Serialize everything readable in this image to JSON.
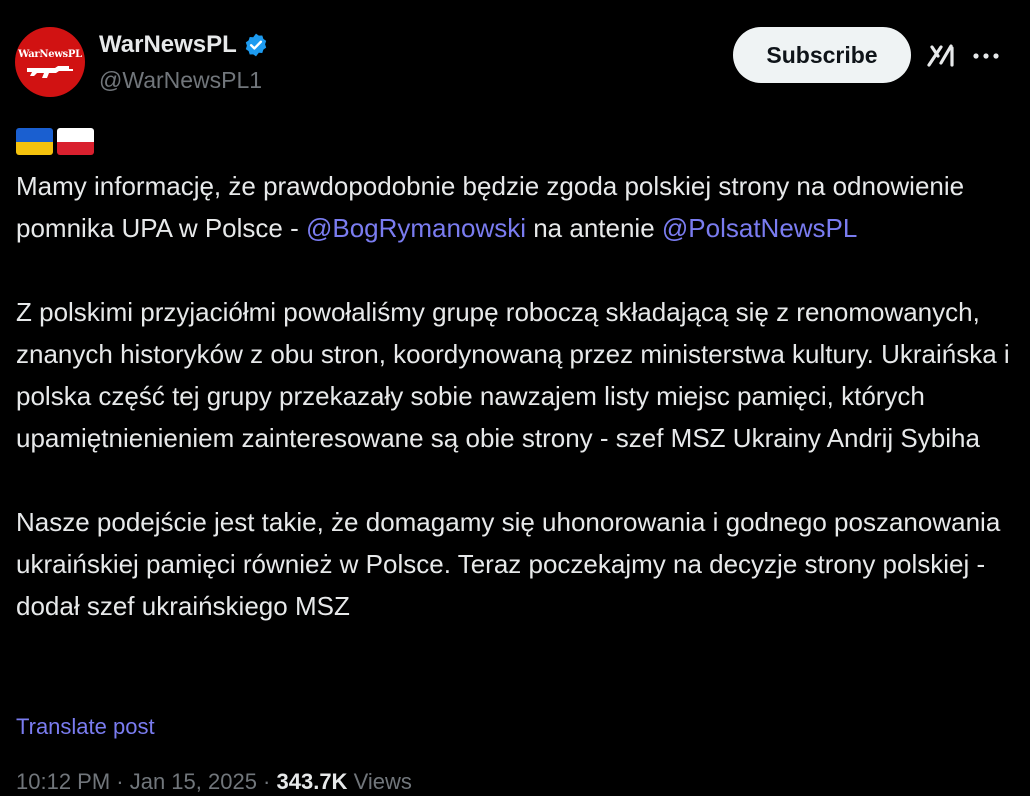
{
  "author": {
    "display_name": "WarNewsPL",
    "handle": "@WarNewsPL1",
    "avatar_text": "WarNewsPL"
  },
  "actions": {
    "subscribe_label": "Subscribe",
    "grok_icon": "grok-icon",
    "more_icon": "more-options-icon"
  },
  "flags": [
    "ukraine-flag",
    "poland-flag"
  ],
  "post": {
    "p1": {
      "text_a": "Mamy informację, że prawdopodobnie będzie zgoda polskiej strony na odnowienie pomnika UPA w Polsce - ",
      "mention_1": "@BogRymanowski",
      "text_b": " na antenie ",
      "mention_2": "@PolsatNewsPL"
    },
    "p2": "Z polskimi przyjaciółmi powołaliśmy grupę roboczą składającą się z renomowanych, znanych historyków z obu stron, koordynowaną przez ministerstwa kultury. Ukraińska i polska część tej grupy przekazały sobie nawzajem listy miejsc pamięci, których upamiętnienieniem zainteresowane są obie strony - szef MSZ Ukrainy Andrij Sybiha",
    "p3": "Nasze podejście jest takie, że domagamy się uhonorowania i godnego poszanowania ukraińskiej pamięci również w Polsce. Teraz poczekajmy na decyzje strony polskiej - dodał szef ukraińskiego MSZ"
  },
  "translate_label": "Translate post",
  "meta": {
    "time": "10:12 PM · Jan 15, 2025 · ",
    "views": "343.7K",
    "views_label": " Views"
  },
  "colors": {
    "background": "#000000",
    "text": "#e7e9ea",
    "muted": "#71767b",
    "link": "#7a7cf0",
    "verified": "#1d9bf0",
    "avatar": "#d11212"
  }
}
